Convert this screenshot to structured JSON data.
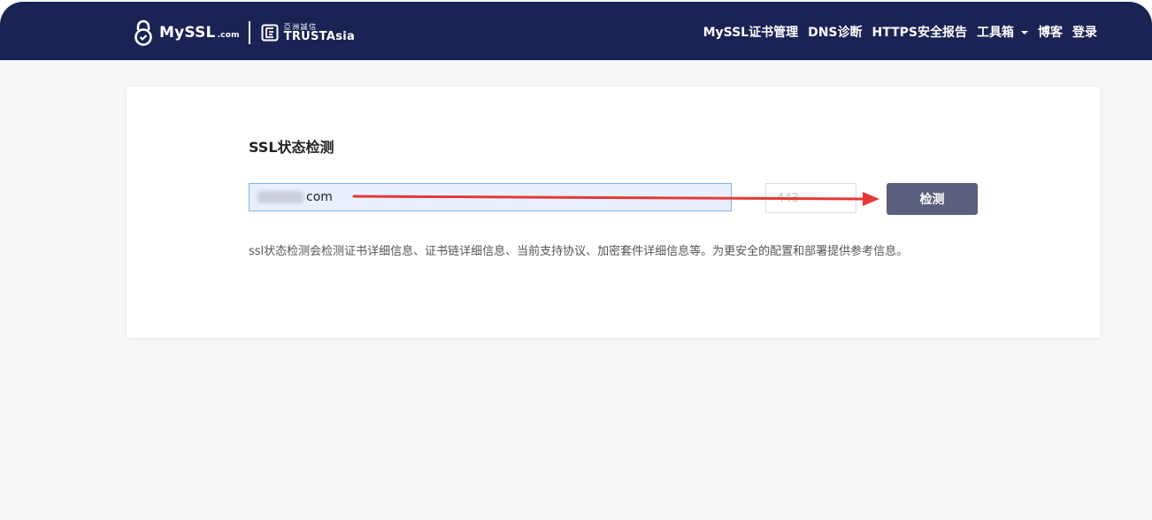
{
  "header": {
    "logo_text": "MySSL",
    "logo_domain": ".com",
    "partner_cn": "亞洲誠信",
    "partner_en": "TRUSTAsia",
    "nav": [
      {
        "label": "MySSL证书管理"
      },
      {
        "label": "DNS诊断"
      },
      {
        "label": "HTTPS安全报告"
      },
      {
        "label": "工具箱"
      },
      {
        "label": "博客"
      },
      {
        "label": "登录"
      }
    ]
  },
  "main": {
    "title": "SSL状态检测",
    "domain_value": "com",
    "port_placeholder": "443",
    "check_label": "检测",
    "description": "ssl状态检测会检测证书详细信息、证书链详细信息、当前支持协议、加密套件详细信息等。为更安全的配置和部署提供参考信息。"
  },
  "colors": {
    "header_bg": "#1b2355",
    "button_bg": "#5b5f7e",
    "annotation_arrow": "#e53935"
  }
}
